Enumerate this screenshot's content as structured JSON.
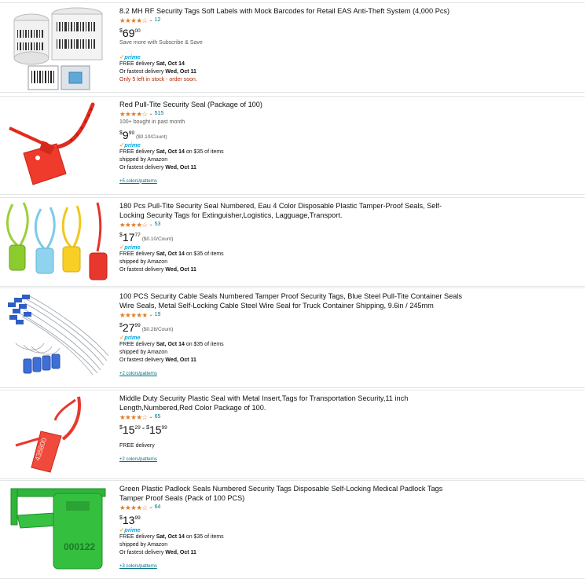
{
  "results": [
    {
      "title": "8.2 MH RF Security Tags Soft Labels with Mock Barcodes for Retail EAS Anti-Theft System (4,000 Pcs)",
      "stars": "★★★★☆",
      "rating_value": 4.5,
      "review_count": "12",
      "bought": "",
      "price": {
        "symbol": "$",
        "whole": "69",
        "fraction": "00"
      },
      "price_high": null,
      "unit_price": "",
      "subscribe": "Save more with Subscribe & Save",
      "prime": true,
      "delivery_prefix": "FREE delivery ",
      "delivery_date": "Sat, Oct 14",
      "delivery_suffix": "",
      "shipped_by": "",
      "fastest_prefix": "Or fastest delivery ",
      "fastest_date": "Wed, Oct 11",
      "stock": "Only 5 left in stock - order soon.",
      "colors_link": "",
      "thumbnail_icon": "rf-label-rolls"
    },
    {
      "title": "Red Pull-Tite Security Seal (Package of 100)",
      "stars": "★★★★☆",
      "rating_value": 4.5,
      "review_count": "515",
      "bought": "100+ bought in past month",
      "price": {
        "symbol": "$",
        "whole": "9",
        "fraction": "99"
      },
      "price_high": null,
      "unit_price": "($0.10/Count)",
      "subscribe": "",
      "prime": true,
      "delivery_prefix": "FREE delivery ",
      "delivery_date": "Sat, Oct 14",
      "delivery_suffix": " on $35 of items",
      "shipped_by": "shipped by Amazon",
      "fastest_prefix": "Or fastest delivery ",
      "fastest_date": "Wed, Oct 11",
      "stock": "",
      "colors_link": "+5 colors/patterns",
      "thumbnail_icon": "red-pull-seal"
    },
    {
      "title": "180 Pcs Pull-Tite Security Seal Numbered, Eau 4 Color Disposable Plastic Tamper-Proof Seals, Self-Locking Security Tags for Extinguisher,Logistics, Lagguage,Transport.",
      "stars": "★★★★☆",
      "rating_value": 4.0,
      "review_count": "53",
      "bought": "",
      "price": {
        "symbol": "$",
        "whole": "17",
        "fraction": "77"
      },
      "price_high": null,
      "unit_price": "($0.10/Count)",
      "subscribe": "",
      "prime": true,
      "delivery_prefix": "FREE delivery ",
      "delivery_date": "Sat, Oct 14",
      "delivery_suffix": " on $35 of items",
      "shipped_by": "shipped by Amazon",
      "fastest_prefix": "Or fastest delivery ",
      "fastest_date": "Wed, Oct 11",
      "stock": "",
      "colors_link": "",
      "thumbnail_icon": "four-color-seals"
    },
    {
      "title": "100 PCS Security Cable Seals Numbered Tamper Proof Security Tags, Blue Steel Pull-Tite Container Seals Wire Seals, Metal Self-Locking Cable Steel Wire Seal for Truck Container Shipping, 9.6in / 245mm",
      "stars": "★★★★★",
      "rating_value": 5.0,
      "review_count": "19",
      "bought": "",
      "price": {
        "symbol": "$",
        "whole": "27",
        "fraction": "99"
      },
      "price_high": null,
      "unit_price": "($0.28/Count)",
      "subscribe": "",
      "prime": true,
      "delivery_prefix": "FREE delivery ",
      "delivery_date": "Sat, Oct 14",
      "delivery_suffix": " on $35 of items",
      "shipped_by": "shipped by Amazon",
      "fastest_prefix": "Or fastest delivery ",
      "fastest_date": "Wed, Oct 11",
      "stock": "",
      "colors_link": "+2 colors/patterns",
      "thumbnail_icon": "blue-cable-seals"
    },
    {
      "title": "Middle Duty Security Plastic Seal with Metal Insert,Tags for Transportation Security,11 inch Length,Numbered,Red Color Package of 100.",
      "stars": "★★★★☆",
      "rating_value": 4.5,
      "review_count": "65",
      "bought": "",
      "price": {
        "symbol": "$",
        "whole": "15",
        "fraction": "29"
      },
      "price_high": {
        "symbol": "$",
        "whole": "15",
        "fraction": "99"
      },
      "price_separator": "-",
      "unit_price": "",
      "subscribe": "",
      "prime": false,
      "delivery_prefix": "FREE delivery",
      "delivery_date": "",
      "delivery_suffix": "",
      "shipped_by": "",
      "fastest_prefix": "",
      "fastest_date": "",
      "stock": "",
      "colors_link": "+2 colors/patterns",
      "thumbnail_icon": "red-metal-insert-seal"
    },
    {
      "title": "Green Plastic Padlock Seals Numbered Security Tags Disposable Self-Locking Medical Padlock Tags Tamper Proof Seals (Pack of 100 PCS)",
      "stars": "★★★★☆",
      "rating_value": 4.5,
      "review_count": "64",
      "bought": "",
      "price": {
        "symbol": "$",
        "whole": "13",
        "fraction": "99"
      },
      "price_high": null,
      "unit_price": "",
      "subscribe": "",
      "prime": true,
      "delivery_prefix": "FREE delivery ",
      "delivery_date": "Sat, Oct 14",
      "delivery_suffix": " on $35 of items",
      "shipped_by": "shipped by Amazon",
      "fastest_prefix": "Or fastest delivery ",
      "fastest_date": "Wed, Oct 11",
      "stock": "",
      "colors_link": "+3 colors/patterns",
      "thumbnail_icon": "green-padlock-seal",
      "thumbnail_text": "000122"
    }
  ],
  "prime_label": "prime",
  "prime_check": "✓",
  "colors": {
    "link": "#007185",
    "star": "#de7921",
    "prime": "#00a8e1",
    "stock": "#b12704",
    "border": "#e3e6e6"
  }
}
